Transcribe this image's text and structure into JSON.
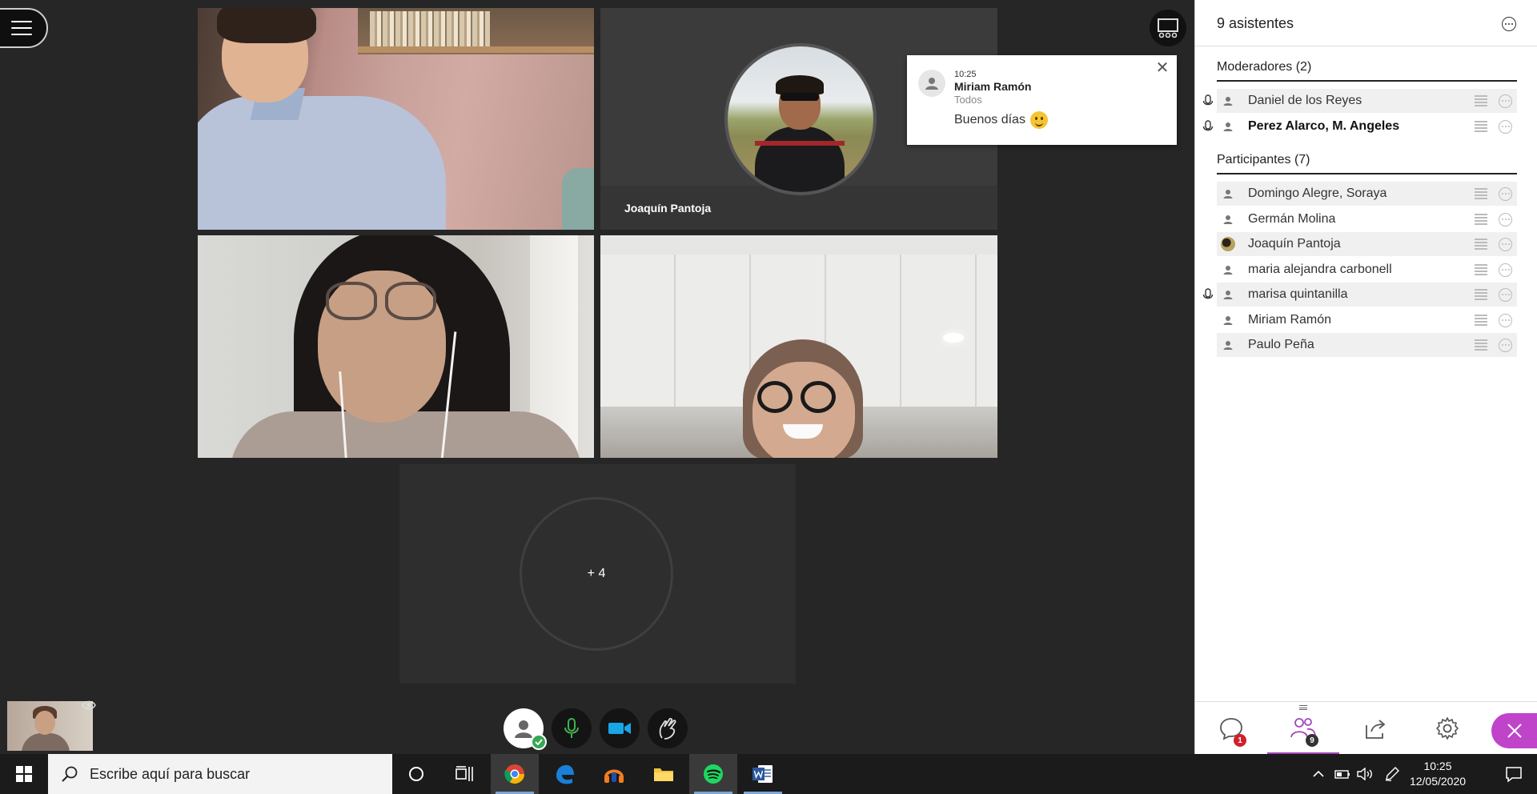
{
  "stage": {
    "tile_name_2": "Joaquín Pantoja",
    "overflow_label": "+ 4"
  },
  "notification": {
    "time": "10:25",
    "sender": "Miriam Ramón",
    "recipient": "Todos",
    "message": "Buenos días"
  },
  "panel": {
    "title": "9 asistentes",
    "moderators_title": "Moderadores (2)",
    "participants_title": "Participantes (7)",
    "moderators": [
      {
        "name": "Daniel de los Reyes",
        "mic": true
      },
      {
        "name": "Perez Alarco, M. Angeles",
        "mic": true
      }
    ],
    "participants": [
      {
        "name": "Domingo Alegre, Soraya",
        "mic": false
      },
      {
        "name": "Germán Molina",
        "mic": false
      },
      {
        "name": "Joaquín Pantoja",
        "mic": false
      },
      {
        "name": "maria alejandra carbonell",
        "mic": false
      },
      {
        "name": "marisa quintanilla",
        "mic": true
      },
      {
        "name": "Miriam Ramón",
        "mic": false
      },
      {
        "name": "Paulo Peña",
        "mic": false
      }
    ],
    "footer": {
      "chat_badge": "1",
      "attendees_badge": "9"
    }
  },
  "taskbar": {
    "search_placeholder": "Escribe aquí para buscar",
    "time": "10:25",
    "date": "12/05/2020"
  },
  "colors": {
    "accent": "#a347ba",
    "close_button": "#c044c9",
    "badge_red": "#d11f2c",
    "stage_bg": "#262626"
  }
}
